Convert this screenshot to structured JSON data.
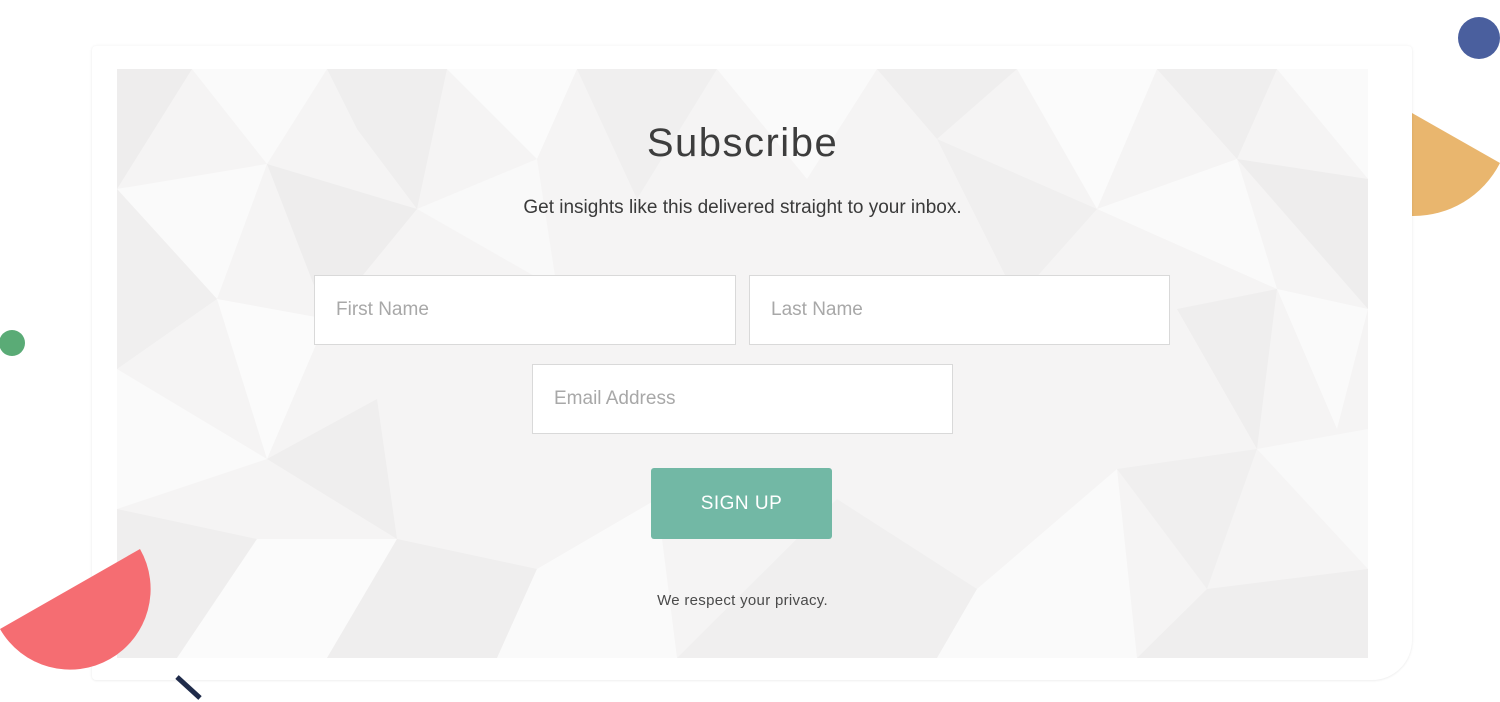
{
  "form": {
    "title": "Subscribe",
    "subtitle": "Get insights like this delivered straight to your inbox.",
    "first_name_placeholder": "First Name",
    "last_name_placeholder": "Last Name",
    "email_placeholder": "Email Address",
    "submit_label": "SIGN UP",
    "privacy_note": "We respect your privacy."
  },
  "colors": {
    "button": "#72b8a5",
    "panel_background": "#f5f4f4",
    "decor_blue": "#4a5f9e",
    "decor_orange": "#e9b66e",
    "decor_green": "#5aab76",
    "decor_red": "#f56d72",
    "decor_navy": "#1f2b4a"
  }
}
